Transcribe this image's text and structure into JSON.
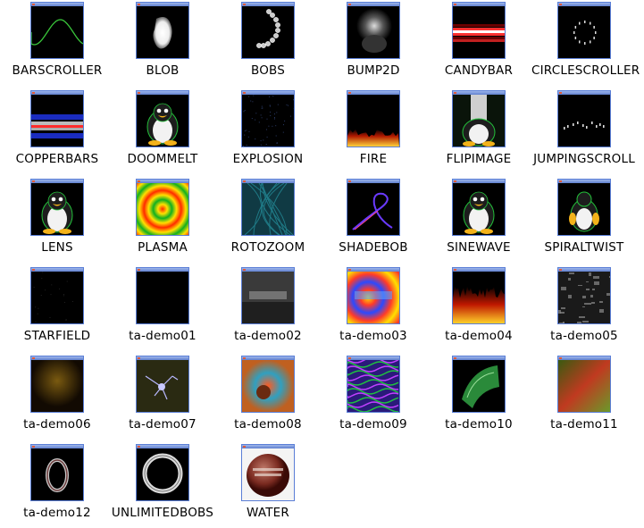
{
  "items": [
    {
      "label": "BARSCROLLER",
      "art": "barscroller"
    },
    {
      "label": "BLOB",
      "art": "blob"
    },
    {
      "label": "BOBS",
      "art": "bobs"
    },
    {
      "label": "BUMP2D",
      "art": "bump2d"
    },
    {
      "label": "CANDYBAR",
      "art": "candybar"
    },
    {
      "label": "CIRCLESCROLLER",
      "art": "circlescroller"
    },
    {
      "label": "COPPERBARS",
      "art": "copperbars"
    },
    {
      "label": "DOOMMELT",
      "art": "penguin"
    },
    {
      "label": "EXPLOSION",
      "art": "explosion"
    },
    {
      "label": "FIRE",
      "art": "fire"
    },
    {
      "label": "FLIPIMAGE",
      "art": "flipimage"
    },
    {
      "label": "JUMPINGSCROLL",
      "art": "jumpingscroll"
    },
    {
      "label": "LENS",
      "art": "penguin"
    },
    {
      "label": "PLASMA",
      "art": "plasma"
    },
    {
      "label": "ROTOZOOM",
      "art": "rotozoom"
    },
    {
      "label": "SHADEBOB",
      "art": "shadebob"
    },
    {
      "label": "SINEWAVE",
      "art": "penguin"
    },
    {
      "label": "SPIRALTWIST",
      "art": "spiraltwist"
    },
    {
      "label": "STARFIELD",
      "art": "starfield"
    },
    {
      "label": "ta-demo01",
      "art": "black"
    },
    {
      "label": "ta-demo02",
      "art": "demomaking"
    },
    {
      "label": "ta-demo03",
      "art": "demomaking-color"
    },
    {
      "label": "ta-demo04",
      "art": "fire2"
    },
    {
      "label": "ta-demo05",
      "art": "grayscape"
    },
    {
      "label": "ta-demo06",
      "art": "brownscape"
    },
    {
      "label": "ta-demo07",
      "art": "fractal"
    },
    {
      "label": "ta-demo08",
      "art": "tunnel"
    },
    {
      "label": "ta-demo09",
      "art": "purplewaves"
    },
    {
      "label": "ta-demo10",
      "art": "greentunnel"
    },
    {
      "label": "ta-demo11",
      "art": "blurwave"
    },
    {
      "label": "ta-demo12",
      "art": "ring"
    },
    {
      "label": "UNLIMITEDBOBS",
      "art": "unlimitedbobs"
    },
    {
      "label": "WATER",
      "art": "water"
    }
  ],
  "colors": {
    "frame": "#5a7ed6",
    "titlebar": "#7f9be0",
    "screen": "#000000"
  }
}
